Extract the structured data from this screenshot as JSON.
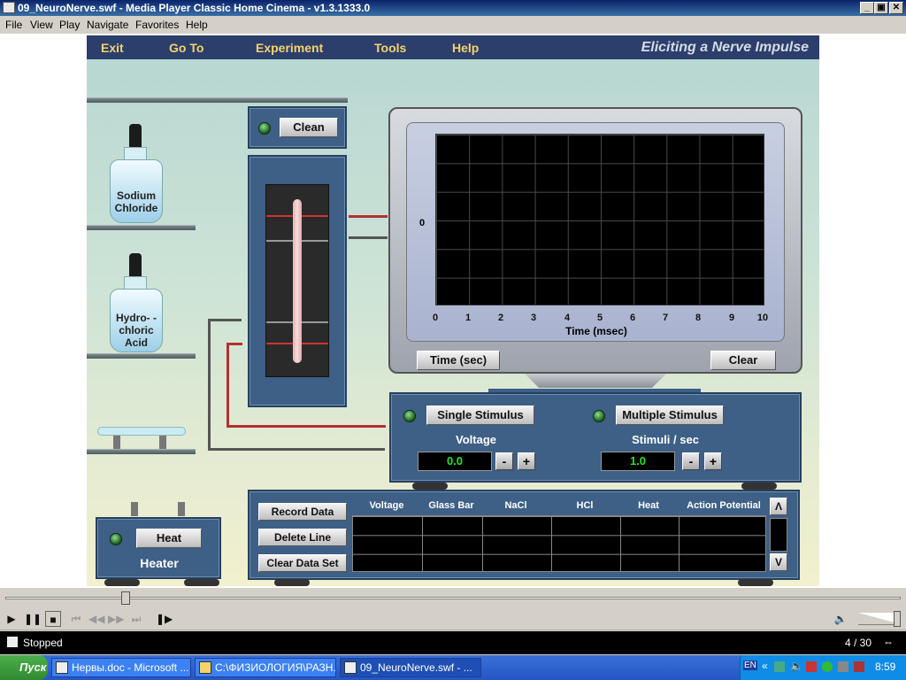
{
  "window": {
    "title": "09_NeuroNerve.swf - Media Player Classic Home Cinema - v1.3.1333.0"
  },
  "menu": [
    "File",
    "View",
    "Play",
    "Navigate",
    "Favorites",
    "Help"
  ],
  "app": {
    "nav": [
      "Exit",
      "Go To",
      "Experiment",
      "Tools",
      "Help"
    ],
    "subtitle": "Eliciting a Nerve Impulse",
    "bottles": {
      "sodium": "Sodium Chloride",
      "hcl": "Hydro- -chloric Acid"
    },
    "clean_button": "Clean",
    "oscilloscope": {
      "y_zero": "0",
      "x_ticks": [
        "0",
        "1",
        "2",
        "3",
        "4",
        "5",
        "6",
        "7",
        "8",
        "9",
        "10"
      ],
      "x_label": "Time (msec)",
      "time_button": "Time (sec)",
      "clear_button": "Clear"
    },
    "stimulator": {
      "single_button": "Single Stimulus",
      "multiple_button": "Multiple Stimulus",
      "voltage_label": "Voltage",
      "voltage_value": "0.0",
      "stimuli_label": "Stimuli / sec",
      "stimuli_value": "1.0",
      "minus": "-",
      "plus": "+"
    },
    "heater": {
      "button": "Heat",
      "label": "Heater"
    },
    "data": {
      "record": "Record Data",
      "delete": "Delete Line",
      "clear": "Clear Data Set",
      "columns": [
        "Voltage",
        "Glass Bar",
        "NaCl",
        "HCl",
        "Heat",
        "Action Potential"
      ],
      "scroll_up": "Λ",
      "scroll_down": "V"
    }
  },
  "player": {
    "status": "Stopped",
    "frame": "4 / 30"
  },
  "taskbar": {
    "start": "Пуск",
    "tasks": [
      "Нервы.doc - Microsoft ...",
      "С:\\ФИЗИОЛОГИЯ\\РАЗН...",
      "09_NeuroNerve.swf - ..."
    ],
    "lang": "EN",
    "clock": "8:59"
  }
}
